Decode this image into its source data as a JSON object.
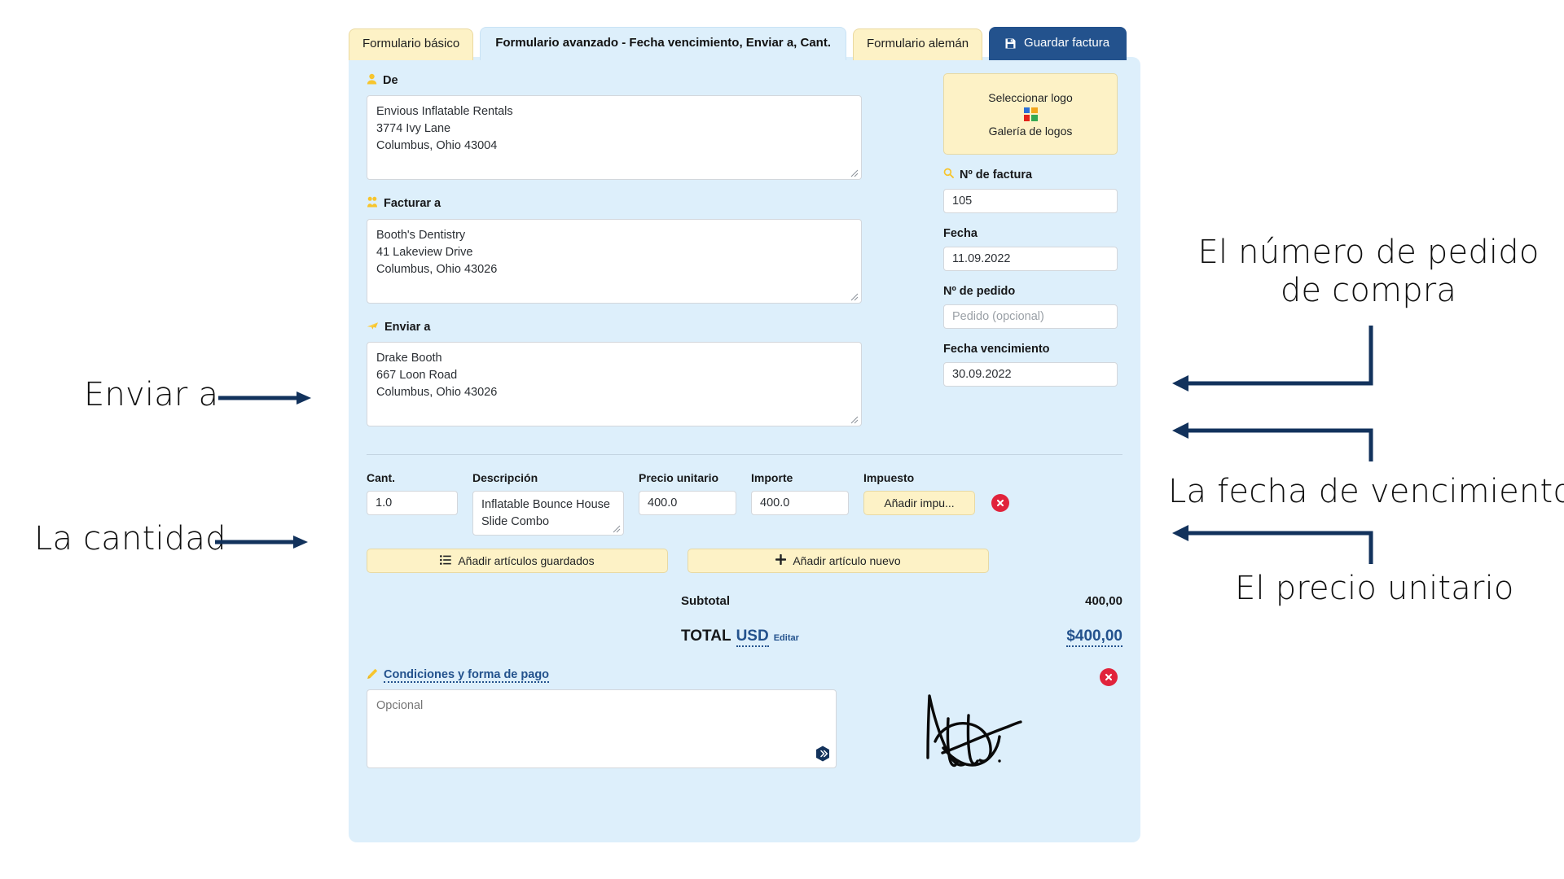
{
  "tabs": [
    {
      "label": "Formulario básico",
      "state": "inactive"
    },
    {
      "label": "Formulario avanzado - Fecha vencimiento, Enviar a, Cant.",
      "state": "active"
    },
    {
      "label": "Formulario alemán",
      "state": "inactive"
    },
    {
      "label": "Guardar factura",
      "state": "save",
      "icon": "save-disk-icon"
    }
  ],
  "form": {
    "from": {
      "label": "De",
      "icon": "person-icon",
      "value": "Envious Inflatable Rentals\n3774 Ivy Lane\nColumbus, Ohio 43004"
    },
    "bill_to": {
      "label": "Facturar a",
      "icon": "people-icon",
      "value": "Booth's Dentistry\n41 Lakeview Drive\nColumbus, Ohio 43026"
    },
    "ship_to": {
      "label": "Enviar a",
      "icon": "plane-icon",
      "value": "Drake Booth\n667 Loon Road\nColumbus, Ohio 43026"
    },
    "logo": {
      "select_label": "Seleccionar logo",
      "gallery_label": "Galería de logos",
      "icon": "color-grid-icon",
      "colors": [
        "#2a6fd6",
        "#f2a61d",
        "#e2231a",
        "#34a853"
      ]
    },
    "invoice_number": {
      "label": "Nº de factura",
      "icon": "magnifier-icon",
      "value": "105"
    },
    "date": {
      "label": "Fecha",
      "value": "11.09.2022"
    },
    "po_number": {
      "label": "Nº de pedido",
      "value": "",
      "placeholder": "Pedido (opcional)"
    },
    "due_date": {
      "label": "Fecha vencimiento",
      "value": "30.09.2022"
    }
  },
  "items": {
    "headers": {
      "qty": "Cant.",
      "description": "Descripción",
      "unit_price": "Precio unitario",
      "amount": "Importe",
      "tax": "Impuesto"
    },
    "rows": [
      {
        "qty": "1.0",
        "description": "Inflatable Bounce House Slide Combo",
        "unit_price": "400.0",
        "amount": "400.0",
        "tax_button": "Añadir impu...",
        "delete_icon": "delete-circle-icon"
      }
    ],
    "add_saved_label": "Añadir artículos guardados",
    "add_saved_icon": "list-icon",
    "add_new_label": "Añadir artículo nuevo",
    "add_new_icon": "plus-icon"
  },
  "totals": {
    "subtotal_label": "Subtotal",
    "subtotal_value": "400,00",
    "total_label": "TOTAL",
    "currency": "USD",
    "edit_label": "Editar",
    "total_value": "$400,00"
  },
  "terms": {
    "label": "Condiciones y forma de pago",
    "icon": "pencil-icon",
    "value": "",
    "placeholder": "Opcional",
    "expand_icon": "hex-expand-icon",
    "delete_icon": "delete-circle-icon",
    "signature_icon": "handwritten-signature"
  },
  "annotations": [
    {
      "id": "ship-to-note",
      "text": "Enviar a",
      "arrow": "right"
    },
    {
      "id": "qty-note",
      "text": "La cantidad",
      "arrow": "right"
    },
    {
      "id": "po-note",
      "text": "El número de pedido\nde compra",
      "arrow": "elbow-left"
    },
    {
      "id": "due-date-note",
      "text": "La fecha de vencimiento",
      "arrow": "elbow-left"
    },
    {
      "id": "price-note",
      "text": "El precio unitario",
      "arrow": "elbow-left"
    }
  ],
  "colors": {
    "card_bg": "#ddeffb",
    "tab_yellow": "#fdf2c6",
    "tab_blue": "#23528d",
    "accent_blue": "#23528d",
    "danger_red": "#e1233b",
    "annotation_navy": "#12325c"
  }
}
